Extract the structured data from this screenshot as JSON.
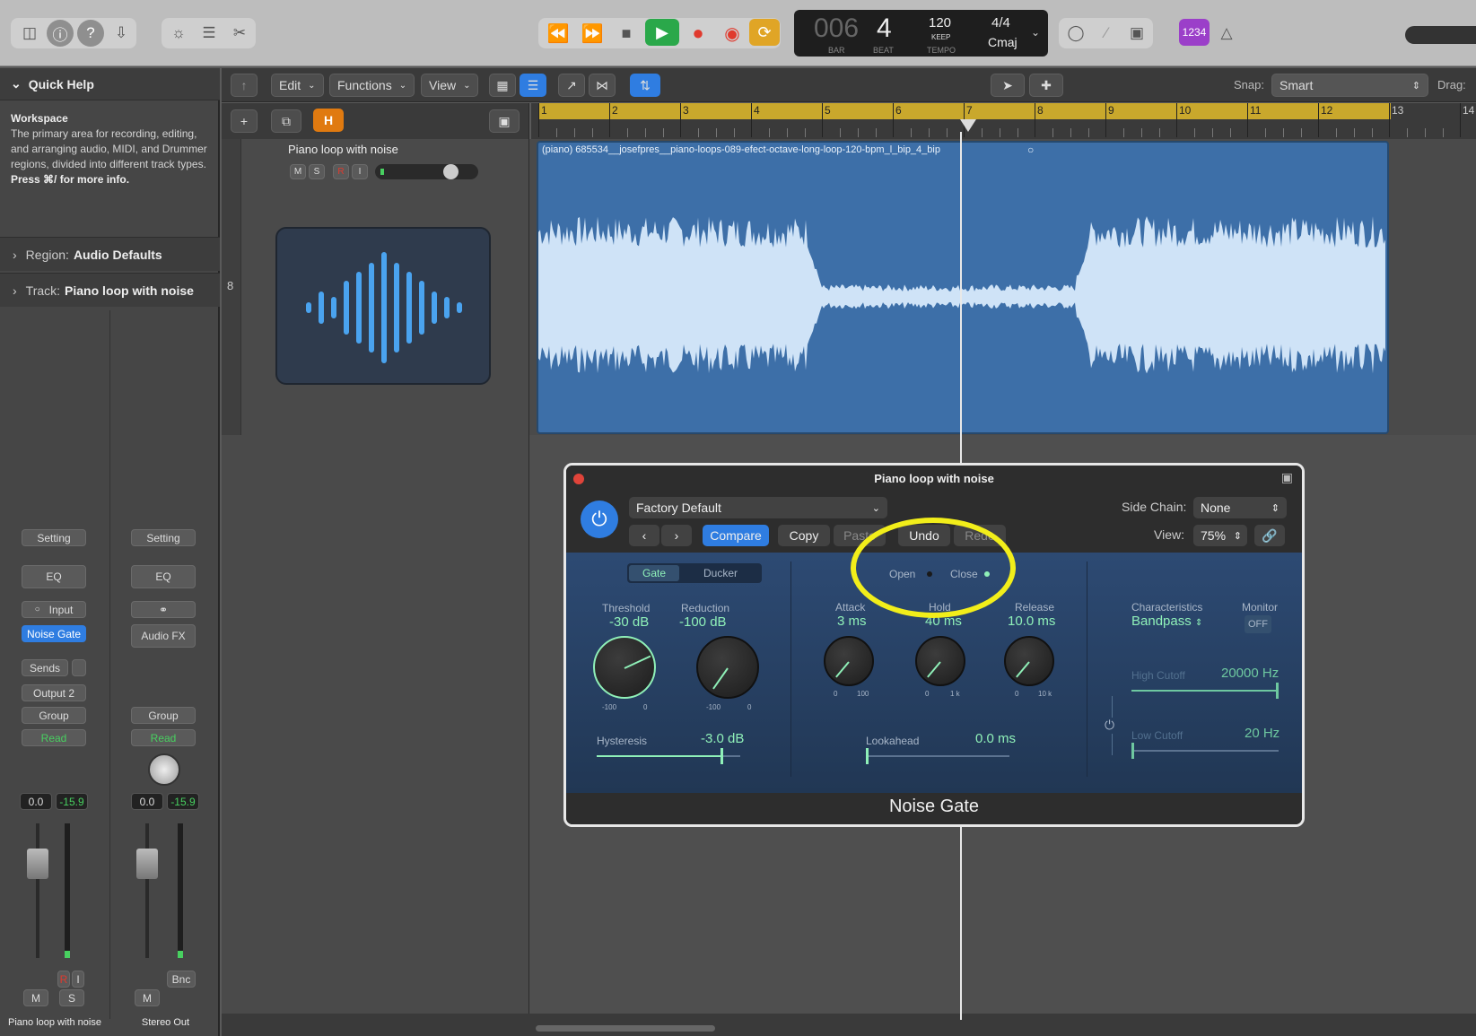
{
  "toolbar": {
    "lcd": {
      "bar": "006",
      "beat": "4",
      "bar_label": "BAR",
      "beat_label": "BEAT",
      "tempo": "120",
      "tempo_mode": "KEEP",
      "tempo_label": "TEMPO",
      "signature": "4/4",
      "key": "Cmaj"
    },
    "count_in": "1234"
  },
  "quick_help": {
    "header": "Quick Help",
    "title": "Workspace",
    "body": "The primary area for recording, editing, and arranging audio, MIDI, and Drummer regions, divided into different track types.",
    "shortcut": "Press ⌘/ for more info."
  },
  "inspector": {
    "region_label": "Region:",
    "region_value": "Audio Defaults",
    "track_label": "Track:",
    "track_value": "Piano loop with noise"
  },
  "strip1": {
    "setting": "Setting",
    "eq": "EQ",
    "input": "Input",
    "plugin": "Noise Gate",
    "sends": "Sends",
    "output": "Output 2",
    "group": "Group",
    "automation": "Read",
    "vol": "0.0",
    "peak": "-15.9",
    "r": "R",
    "i": "I",
    "m": "M",
    "s": "S",
    "name": "Piano loop with noise"
  },
  "strip2": {
    "setting": "Setting",
    "eq": "EQ",
    "audiofx": "Audio FX",
    "group": "Group",
    "automation": "Read",
    "vol": "0.0",
    "peak": "-15.9",
    "bnc": "Bnc",
    "m": "M",
    "name": "Stereo Out"
  },
  "menubar": {
    "edit": "Edit",
    "functions": "Functions",
    "view": "View",
    "snap_label": "Snap:",
    "snap_value": "Smart",
    "drag_label": "Drag:",
    "h": "H"
  },
  "ruler": {
    "marks": [
      "1",
      "2",
      "3",
      "4",
      "5",
      "6",
      "7",
      "8",
      "9",
      "10",
      "11",
      "12",
      "13",
      "14"
    ]
  },
  "track": {
    "number": "8",
    "name": "Piano loop with noise",
    "m": "M",
    "s": "S",
    "r": "R",
    "i": "I",
    "region_name": "(piano) 685534__josefpres__piano-loops-089-efect-octave-long-loop-120-bpm_l_bip_4_bip"
  },
  "plugin": {
    "title": "Piano loop with noise",
    "preset": "Factory Default",
    "compare": "Compare",
    "copy": "Copy",
    "paste": "Paste",
    "undo": "Undo",
    "redo": "Redo",
    "side_chain_label": "Side Chain:",
    "side_chain_value": "None",
    "view_label": "View:",
    "view_value": "75%",
    "mode_gate": "Gate",
    "mode_ducker": "Ducker",
    "open": "Open",
    "close": "Close",
    "threshold_label": "Threshold",
    "threshold_value": "-30 dB",
    "threshold_min": "-100",
    "threshold_max": "0",
    "reduction_label": "Reduction",
    "reduction_value": "-100 dB",
    "reduction_min": "-100",
    "reduction_max": "0",
    "attack_label": "Attack",
    "attack_value": "3 ms",
    "attack_min": "0",
    "attack_max": "100",
    "hold_label": "Hold",
    "hold_value": "40 ms",
    "hold_min": "0",
    "hold_max": "1 k",
    "release_label": "Release",
    "release_value": "10.0 ms",
    "release_min": "0",
    "release_max": "10 k",
    "hysteresis_label": "Hysteresis",
    "hysteresis_value": "-3.0 dB",
    "lookahead_label": "Lookahead",
    "lookahead_value": "0.0 ms",
    "characteristics_label": "Characteristics",
    "characteristics_value": "Bandpass",
    "monitor_label": "Monitor",
    "monitor_value": "OFF",
    "high_cutoff_label": "High Cutoff",
    "high_cutoff_value": "20000 Hz",
    "low_cutoff_label": "Low Cutoff",
    "low_cutoff_value": "20 Hz",
    "footer": "Noise Gate"
  },
  "colors": {
    "accent_blue": "#2f7de1",
    "play_green": "#2aa84a",
    "record_red": "#e03a2e",
    "cycle_yellow": "#e0a526",
    "ruler_yellow": "#c9a82c",
    "region_blue": "#3d6fa8",
    "wave_light": "#cfe3f7",
    "highlight_circle": "#f2ee1a"
  }
}
